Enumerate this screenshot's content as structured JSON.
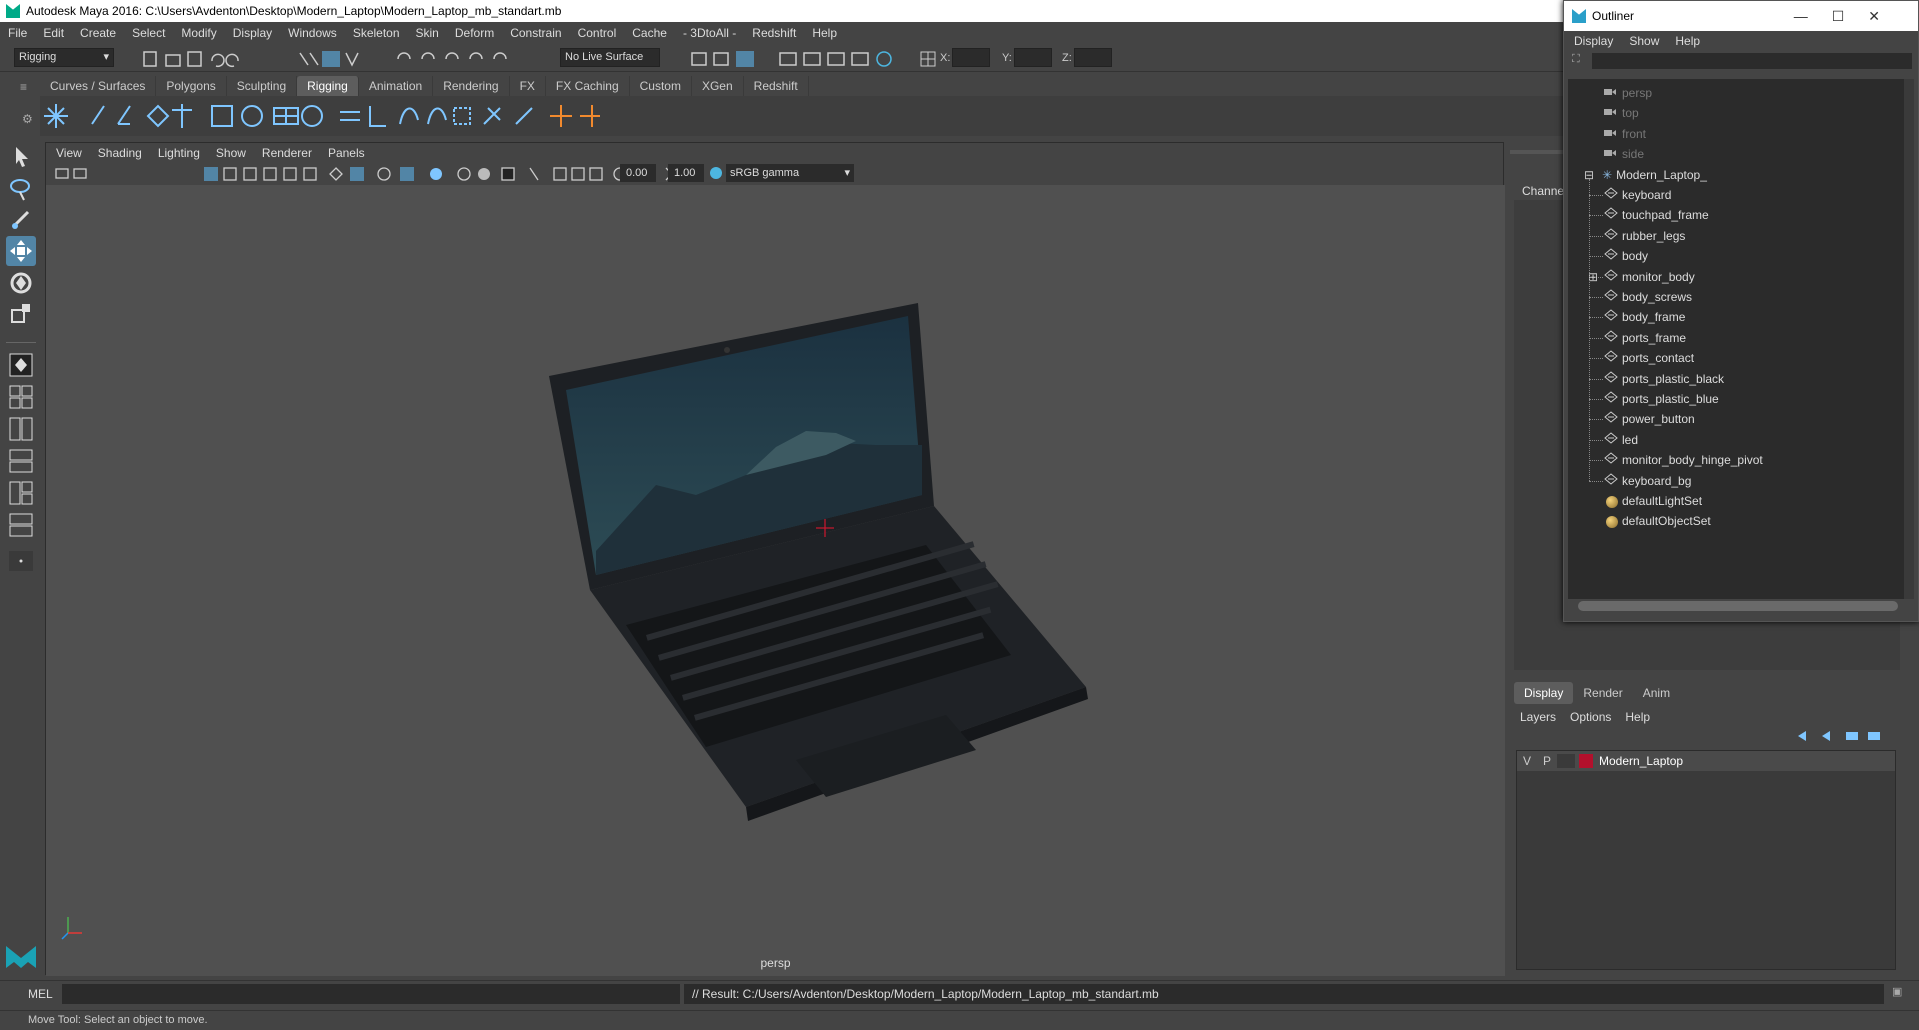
{
  "window": {
    "title": "Autodesk Maya 2016: C:\\Users\\Avdenton\\Desktop\\Modern_Laptop\\Modern_Laptop_mb_standart.mb"
  },
  "menubar": [
    "File",
    "Edit",
    "Create",
    "Select",
    "Modify",
    "Display",
    "Windows",
    "Skeleton",
    "Skin",
    "Deform",
    "Constrain",
    "Control",
    "Cache",
    "- 3DtoAll -",
    "Redshift",
    "Help"
  ],
  "statusline": {
    "menuset": "Rigging",
    "live_surface": "No Live Surface",
    "x_label": "X:",
    "y_label": "Y:",
    "z_label": "Z:"
  },
  "shelf_tabs": [
    {
      "label": "Curves / Surfaces",
      "active": false
    },
    {
      "label": "Polygons",
      "active": false
    },
    {
      "label": "Sculpting",
      "active": false
    },
    {
      "label": "Rigging",
      "active": true
    },
    {
      "label": "Animation",
      "active": false
    },
    {
      "label": "Rendering",
      "active": false
    },
    {
      "label": "FX",
      "active": false
    },
    {
      "label": "FX Caching",
      "active": false
    },
    {
      "label": "Custom",
      "active": false
    },
    {
      "label": "XGen",
      "active": false
    },
    {
      "label": "Redshift",
      "active": false
    }
  ],
  "viewport": {
    "menu": [
      "View",
      "Shading",
      "Lighting",
      "Show",
      "Renderer",
      "Panels"
    ],
    "exposure": "0.00",
    "gamma": "1.00",
    "colorspace": "sRGB gamma",
    "camera_label": "persp"
  },
  "channel_box": {
    "label": "Channel"
  },
  "layer_panel": {
    "tabs": [
      {
        "label": "Display",
        "active": true
      },
      {
        "label": "Render",
        "active": false
      },
      {
        "label": "Anim",
        "active": false
      }
    ],
    "menu": [
      "Layers",
      "Options",
      "Help"
    ],
    "layers": [
      {
        "v": "V",
        "p": "P",
        "name": "Modern_Laptop",
        "color": "#b3102c"
      }
    ]
  },
  "outliner": {
    "title": "Outliner",
    "menu": [
      "Display",
      "Show",
      "Help"
    ],
    "cameras": [
      "persp",
      "top",
      "front",
      "side"
    ],
    "group": "Modern_Laptop_",
    "children": [
      "keyboard",
      "touchpad_frame",
      "rubber_legs",
      "body",
      "monitor_body",
      "body_screws",
      "body_frame",
      "ports_frame",
      "ports_contact",
      "ports_plastic_black",
      "ports_plastic_blue",
      "power_button",
      "led",
      "monitor_body_hinge_pivot",
      "keyboard_bg"
    ],
    "sets": [
      "defaultLightSet",
      "defaultObjectSet"
    ]
  },
  "cmdline": {
    "label": "MEL",
    "result": "// Result: C:/Users/Avdenton/Desktop/Modern_Laptop/Modern_Laptop_mb_standart.mb"
  },
  "helpline": "Move Tool: Select an object to move.",
  "colors": {
    "accent": "#5285a6",
    "layer_color": "#b3102c"
  }
}
